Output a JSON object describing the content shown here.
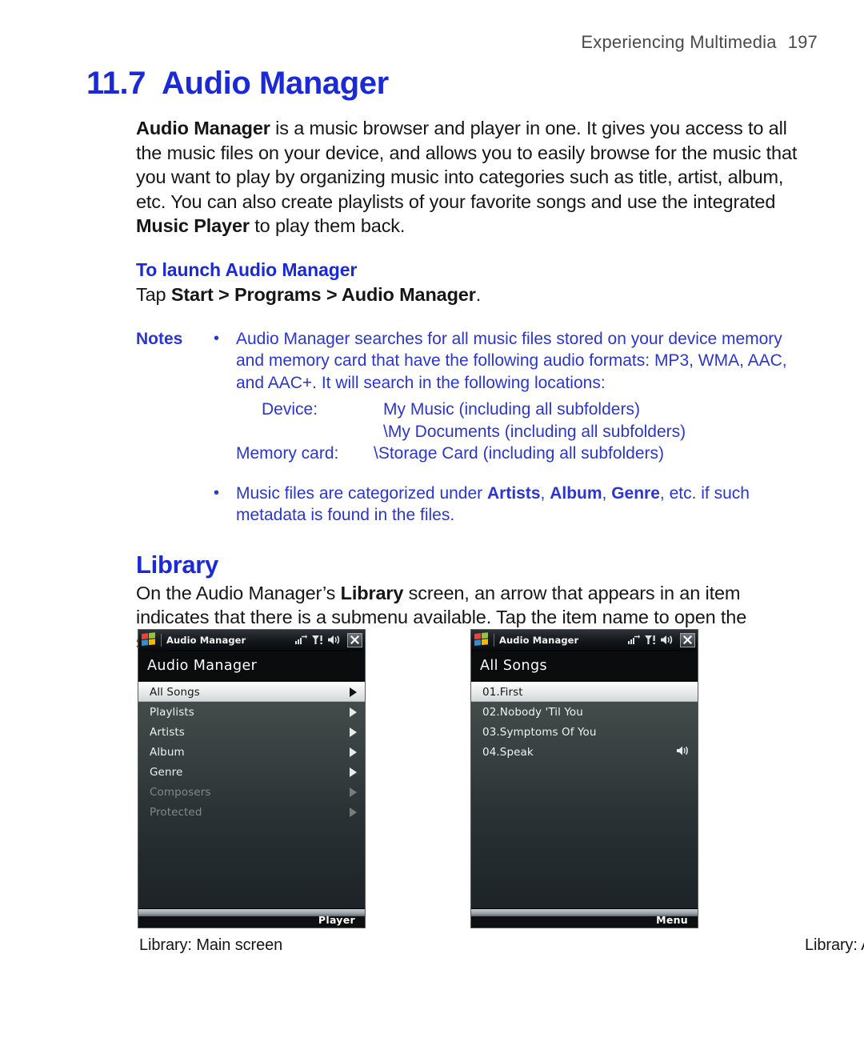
{
  "page": {
    "running_head": "Experiencing Multimedia",
    "page_number": "197"
  },
  "section": {
    "number": "11.7",
    "title": "Audio Manager"
  },
  "intro": {
    "lead_bold": "Audio Manager",
    "text_1": " is a music browser and player in one. It gives you access to all the music files on your device, and allows you to easily browse for the music that you want to play by organizing music into categories such as title, artist, album, etc. You can also create playlists of your favorite songs and use the integrated ",
    "bold_2": "Music Player",
    "text_2": " to play them back."
  },
  "launch": {
    "heading": "To launch Audio Manager",
    "tap_prefix": "Tap ",
    "tap_path": "Start > Programs > Audio Manager",
    "tap_suffix": "."
  },
  "notes": {
    "label": "Notes",
    "bullet": "•",
    "note1": {
      "text": "Audio Manager searches for all music files stored on your device memory and memory card that have the following audio formats: MP3, WMA, AAC, and AAC+. It will search in the following locations:",
      "locations": {
        "device_key": "Device:",
        "device_val_1": "My Music (including all subfolders)",
        "device_val_2": "\\My Documents (including all subfolders)",
        "card_key": "Memory card:",
        "card_val": "\\Storage Card (including all subfolders)"
      }
    },
    "note2": {
      "part_1": "Music files are categorized under ",
      "bold_1": "Artists",
      "part_2": ", ",
      "bold_2": "Album",
      "part_3": ", ",
      "bold_3": "Genre",
      "part_4": ", etc. if such metadata is found in the files."
    }
  },
  "library": {
    "heading": "Library",
    "para_1": "On the Audio Manager’s ",
    "para_bold": "Library",
    "para_2": " screen, an arrow that appears in an item indicates that there is a submenu available. Tap the item name to open the submenu."
  },
  "screenshot_left": {
    "titlebar_title": "Audio Manager",
    "app_header": "Audio Manager",
    "items": [
      {
        "label": "All Songs",
        "selected": true,
        "disabled": false,
        "arrow": true
      },
      {
        "label": "Playlists",
        "selected": false,
        "disabled": false,
        "arrow": true
      },
      {
        "label": "Artists",
        "selected": false,
        "disabled": false,
        "arrow": true
      },
      {
        "label": "Album",
        "selected": false,
        "disabled": false,
        "arrow": true
      },
      {
        "label": "Genre",
        "selected": false,
        "disabled": false,
        "arrow": true
      },
      {
        "label": "Composers",
        "selected": false,
        "disabled": true,
        "arrow": true
      },
      {
        "label": "Protected",
        "selected": false,
        "disabled": true,
        "arrow": true
      }
    ],
    "softkey": "Player",
    "caption": "Library: Main screen"
  },
  "screenshot_right": {
    "titlebar_title": "Audio Manager",
    "app_header": "All Songs",
    "items": [
      {
        "label": "01.First",
        "selected": true,
        "disabled": false,
        "speaker": false
      },
      {
        "label": "02.Nobody 'Til You",
        "selected": false,
        "disabled": false,
        "speaker": false
      },
      {
        "label": "03.Symptoms Of You",
        "selected": false,
        "disabled": false,
        "speaker": false
      },
      {
        "label": "04.Speak",
        "selected": false,
        "disabled": false,
        "speaker": true
      }
    ],
    "softkey": "Menu",
    "caption": "Library: All Songs screen"
  },
  "icons": {
    "titlebar": [
      "connectivity-icon",
      "signal-icon",
      "volume-icon",
      "close-icon"
    ]
  },
  "colors": {
    "heading_blue": "#1a2ad6",
    "note_blue": "#2a36cf",
    "body_text": "#161616"
  }
}
